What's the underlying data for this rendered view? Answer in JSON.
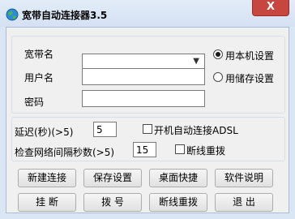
{
  "window": {
    "title": "宽带自动连接器3.5",
    "close_glyph": "X"
  },
  "account": {
    "broadband_label": "宽带名",
    "broadband_value": "",
    "username_label": "用户名",
    "username_value": "",
    "password_label": "密码",
    "password_value": ""
  },
  "settings_source": {
    "local_label": "用本机设置",
    "local_checked": true,
    "stored_label": "用储存设置",
    "stored_checked": false
  },
  "options": {
    "delay_label": "延迟(秒)(>5)",
    "delay_value": "5",
    "check_interval_label": "检查网络间隔秒数(>5)",
    "check_interval_value": "15",
    "autostart_label": "开机自动连接ADSL",
    "autostart_checked": false,
    "redial_label": "断线重拨",
    "redial_checked": false
  },
  "buttons": {
    "new_connection": "新建连接",
    "save_settings": "保存设置",
    "desktop_shortcut": "桌面快捷",
    "help": "软件说明",
    "hangup": "挂 断",
    "dial": "拨 号",
    "reconnect": "断线重拨",
    "exit": "退 出"
  }
}
